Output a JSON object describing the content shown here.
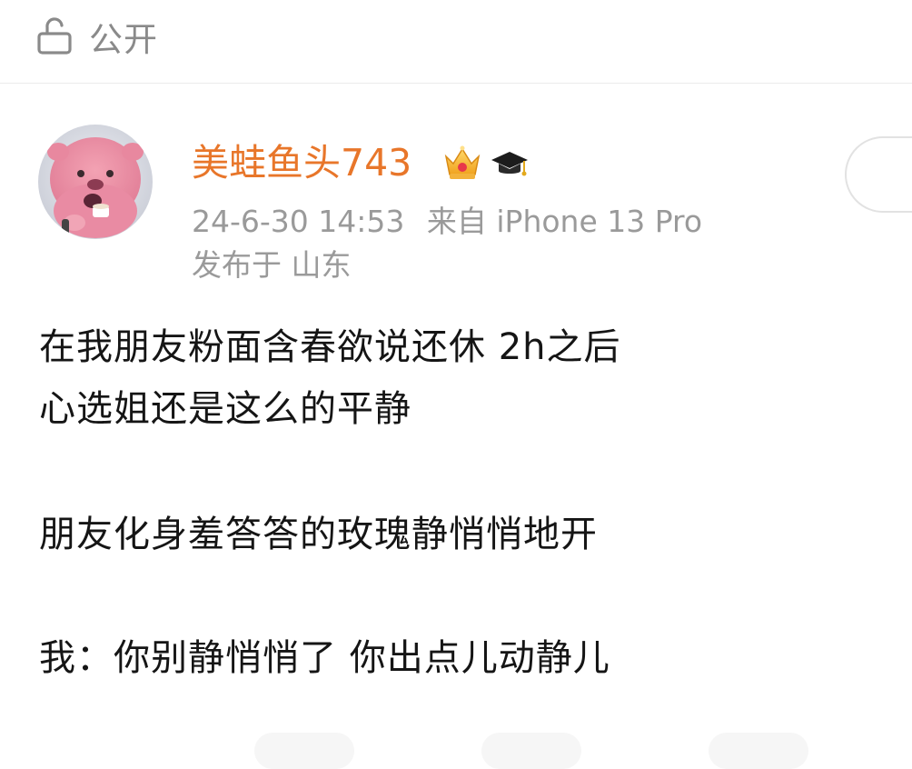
{
  "visibility": {
    "icon": "lock-open-icon",
    "label": "公开"
  },
  "post": {
    "author": {
      "name": "美蛙鱼头743",
      "avatar": "avatar-pink-beaver",
      "badges": [
        "crown-icon",
        "graduation-cap-icon"
      ],
      "name_color": "#e8762a"
    },
    "timestamp": "24-6-30 14:53",
    "source": "来自 iPhone 13 Pro",
    "location": "发布于 山东",
    "text_lines": [
      "在我朋友粉面含春欲说还休 2h之后",
      "心选姐还是这么的平静",
      "朋友化身羞答答的玫瑰静悄悄地开",
      "我：你别静悄悄了 你出点儿动静儿"
    ]
  }
}
